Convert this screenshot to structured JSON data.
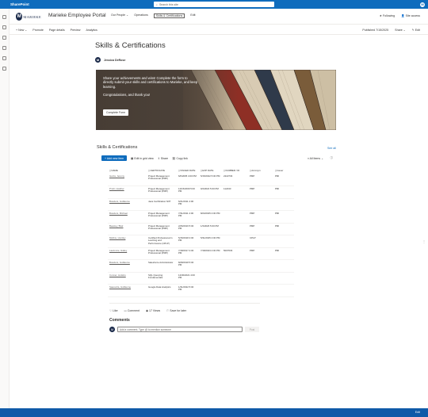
{
  "suite": {
    "app_name": "SharePoint",
    "search_placeholder": "Search this site",
    "avatar_initial": "M"
  },
  "site": {
    "logo_letter": "M",
    "logo_text": "MARIEKE",
    "title": "Marieke Employee Portal"
  },
  "nav": [
    "Our People ⌄",
    "Operations",
    "Skills & Certifications",
    "Edit"
  ],
  "header_right": {
    "following": "Following",
    "site_access": "Site access"
  },
  "commands": {
    "left": [
      "+ New ⌄",
      "Promote",
      "Page details",
      "Preview",
      "Analytics"
    ],
    "published": "Published 7/15/2025",
    "share": "Share ⌄",
    "edit": "Edit"
  },
  "page": {
    "title": "Skills & Certifications",
    "author": "Jessica DeRose",
    "author_initial": "M"
  },
  "hero": {
    "text1": "Share your achievements and wins! Complete the form to directly submit your skills and certifications to Marieke, and keep learning.",
    "text2": "Congratulations, and thank you!",
    "button": "Complete Form"
  },
  "list": {
    "title": "Skills & Certifications",
    "see_all": "See all",
    "new_item": "+ Add new item",
    "grid_view": "Edit in grid view",
    "share": "Share",
    "copy_link": "Copy link",
    "all_items": "All Items ⌄",
    "columns": [
      "NAME",
      "CERTIFICATE",
      "ISSUED DATE",
      "EXP DATE",
      "NUMBER / ID",
      "Acronym",
      "Issuer"
    ],
    "rows": [
      [
        "Garza, Jeremy",
        "Project Management Professional (PMP)",
        "6/6/2005 4:00 PM",
        "5/15/2022 5:00 PM",
        "2222733",
        "PMP",
        "PMI"
      ],
      [
        "Pruitt, Heather",
        "Project Management Professional (PMP)",
        "12/15/2009 5:00 PM",
        "9/4/2022 5:00 PM",
        "112233",
        "PMP",
        "PMI"
      ],
      [
        "Bowders, Guillaume",
        "Java Certification NIIT",
        "6/21/2011 4:00 PM",
        "",
        "",
        "",
        ""
      ],
      [
        "Bowders, Michael",
        "Project Management Professional (PMP)",
        "7/31/2011 4:00 PM",
        "8/23/2025 4:00 PM",
        "",
        "PMP",
        "PMI"
      ],
      [
        "Beasley, Blair",
        "Project Management Professional (PMP)",
        "2/26/2016 5:00 PM",
        "1/3/2026 5:00 PM",
        "",
        "PMP",
        "PMI"
      ],
      [
        "Mullins, Huntley",
        "Certified Professional in Learning and Performance (CPLP)",
        "5/15/2018 4:00 PM",
        "5/31/2025 4:00 PM",
        "",
        "CPLP",
        ""
      ],
      [
        "Lawrence, Hailey",
        "Project Management Professional (PMP)",
        "7/18/2017 4:00 PM",
        "7/18/2023 4:00 PM",
        "5007633",
        "PMP",
        "PMI"
      ],
      [
        "Bowders, Guillaume",
        "Salesforce Administrator",
        "8/28/2018 5:00 PM",
        "",
        "",
        "",
        ""
      ],
      [
        "Conner, Jenkins",
        "SQL Querying Fundamentals",
        "12/30/2021 4:00 PM",
        "",
        "",
        "",
        ""
      ],
      [
        "Saavedra, Guillaume",
        "Google Data Analytics",
        "1/31/2022 5:00 PM",
        "",
        "",
        "",
        ""
      ]
    ]
  },
  "social": {
    "like": "Like",
    "comment": "Comment",
    "views": "17 Views",
    "save": "Save for later"
  },
  "comments": {
    "title": "Comments",
    "placeholder": "Add a comment. Type @ to mention someone",
    "post": "Post"
  },
  "footer": {
    "edit": "Edit"
  }
}
